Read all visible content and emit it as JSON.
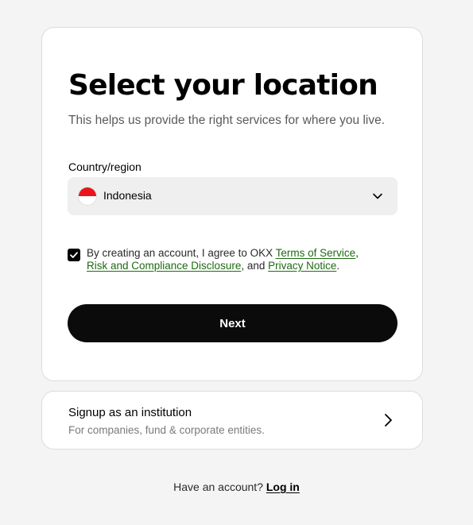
{
  "card": {
    "title": "Select your location",
    "subtitle": "This helps us provide the right services for where you live."
  },
  "country": {
    "label": "Country/region",
    "selected": "Indonesia",
    "flag_icon": "indonesia-flag-icon",
    "dropdown_icon": "chevron-down-icon"
  },
  "consent": {
    "checked": true,
    "prefix": "By creating an account, I agree to OKX ",
    "terms_link": "Terms of Service",
    "sep1": ",",
    "risk_link": "Risk and Compliance Disclosure",
    "sep2": ", and ",
    "privacy_link": "Privacy Notice",
    "suffix": ".",
    "link_color": "#1e6b12"
  },
  "next_button": {
    "label": "Next"
  },
  "institution": {
    "title": "Signup as an institution",
    "subtitle": "For companies, fund & corporate entities.",
    "icon": "chevron-right-icon"
  },
  "footer": {
    "text": "Have an account?",
    "login_link": "Log in"
  }
}
